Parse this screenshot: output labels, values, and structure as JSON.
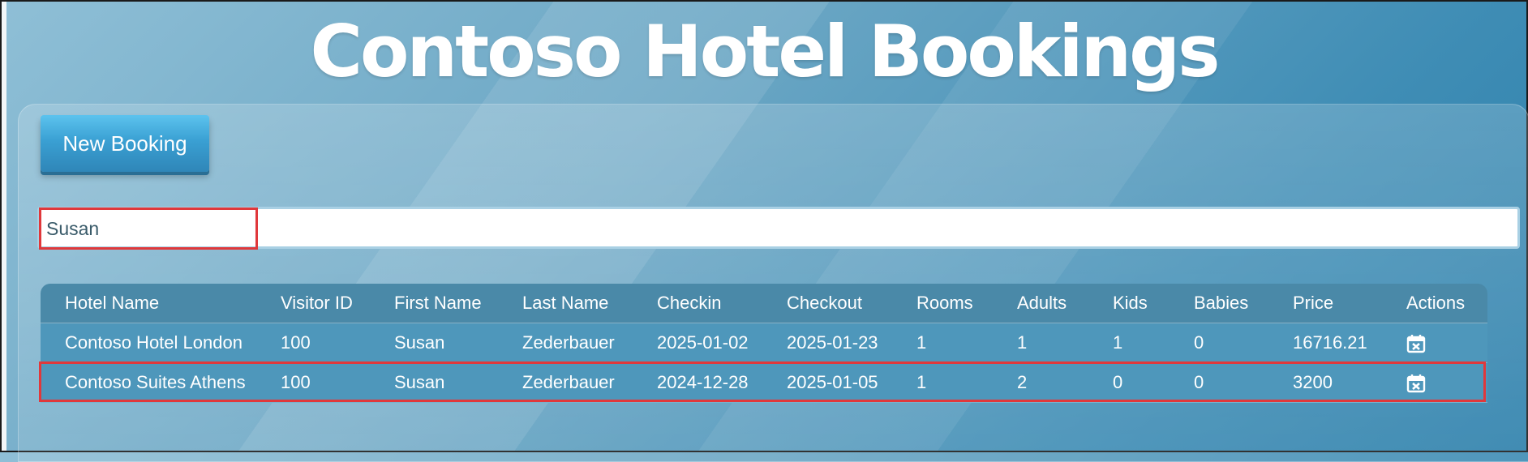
{
  "header": {
    "title": "Contoso Hotel Bookings"
  },
  "toolbar": {
    "new_booking_label": "New Booking"
  },
  "search": {
    "value": "Susan"
  },
  "table": {
    "columns": [
      "Hotel Name",
      "Visitor ID",
      "First Name",
      "Last Name",
      "Checkin",
      "Checkout",
      "Rooms",
      "Adults",
      "Kids",
      "Babies",
      "Price",
      "Actions"
    ],
    "rows": [
      {
        "hotel": "Contoso Hotel London",
        "visitor_id": "100",
        "first_name": "Susan",
        "last_name": "Zederbauer",
        "checkin": "2025-01-02",
        "checkout": "2025-01-23",
        "rooms": "1",
        "adults": "1",
        "kids": "1",
        "babies": "0",
        "price": "16716.21",
        "action_icon": "calendar-cancel-icon"
      },
      {
        "hotel": "Contoso Suites Athens",
        "visitor_id": "100",
        "first_name": "Susan",
        "last_name": "Zederbauer",
        "checkin": "2024-12-28",
        "checkout": "2025-01-05",
        "rooms": "1",
        "adults": "2",
        "kids": "0",
        "babies": "0",
        "price": "3200",
        "action_icon": "calendar-cancel-icon"
      }
    ]
  },
  "colors": {
    "highlight": "#e0383b",
    "button": "#3aa0d3",
    "header_row": "#4a89a8",
    "data_row": "#4e97bb"
  }
}
